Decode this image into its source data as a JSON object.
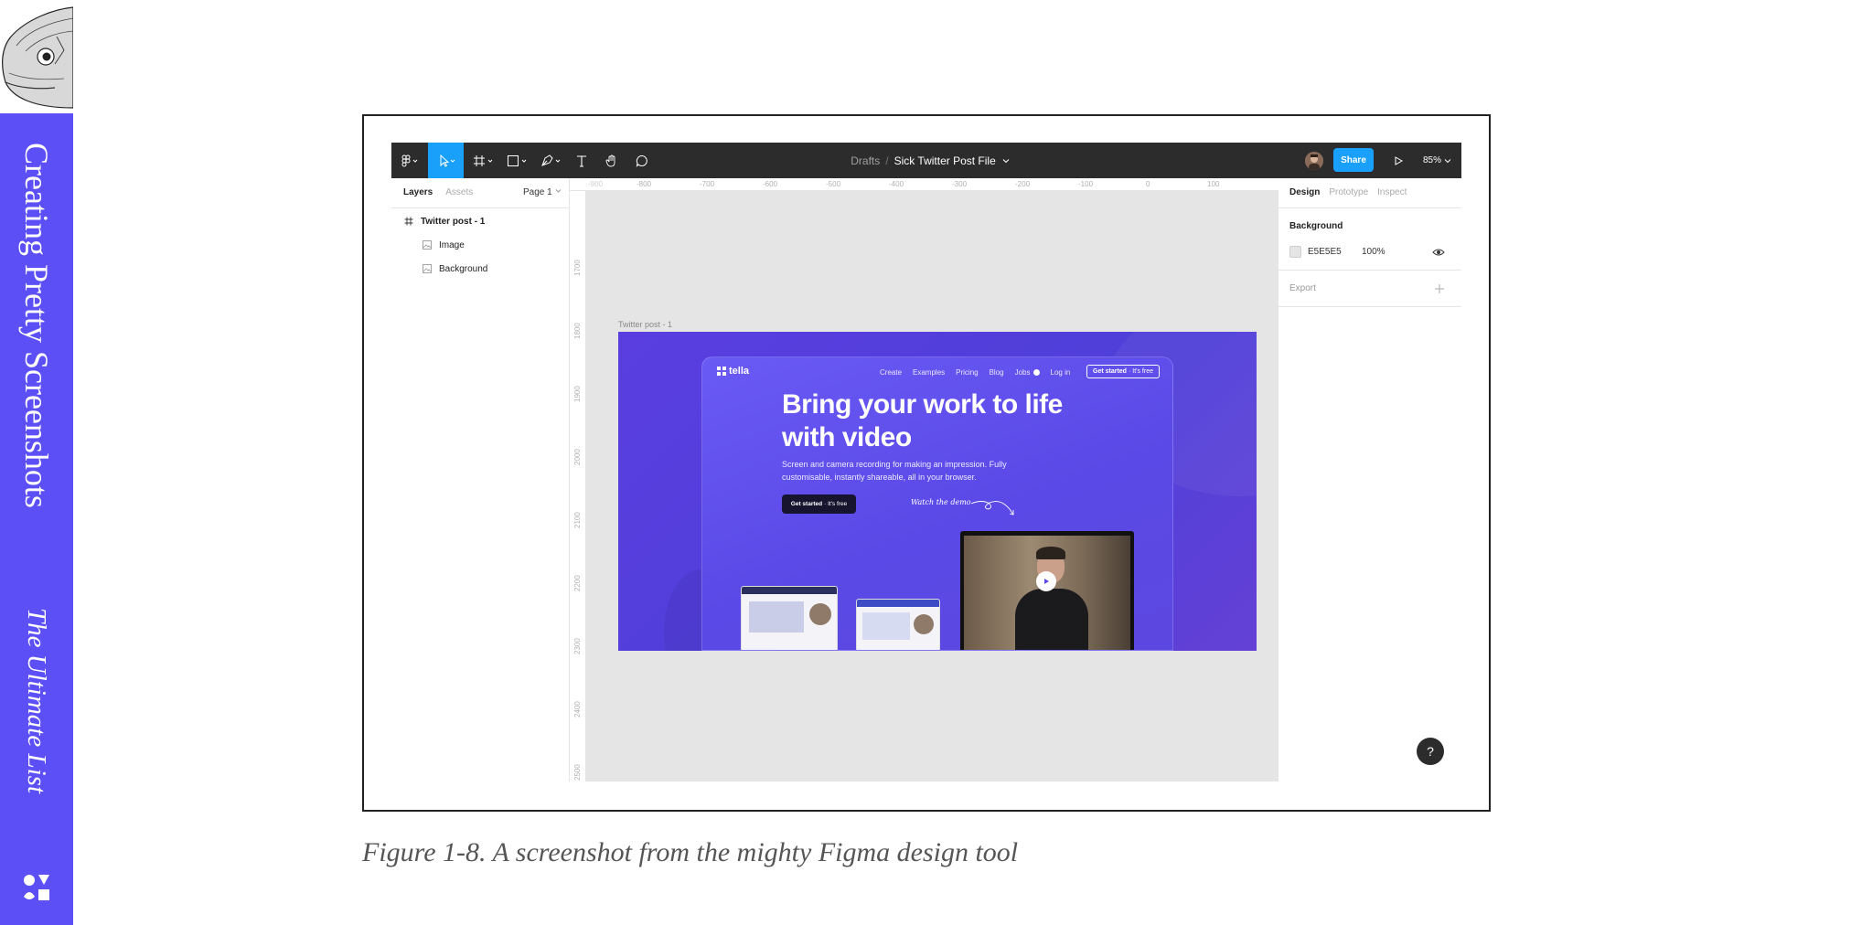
{
  "book": {
    "title": "Creating Pretty Screenshots",
    "subtitle": "The Ultimate List"
  },
  "caption": "Figure 1-8. A screenshot from the mighty Figma design tool",
  "figma": {
    "breadcrumb": {
      "drafts": "Drafts",
      "separator": "/",
      "file_name": "Sick Twitter Post File"
    },
    "share_label": "Share",
    "zoom_label": "85%",
    "left_panel": {
      "tabs": [
        "Layers",
        "Assets"
      ],
      "page_selector": "Page 1",
      "layers": [
        "Twitter post - 1",
        "Image",
        "Background"
      ]
    },
    "rulers": {
      "top": [
        "-900",
        "-800",
        "-700",
        "-600",
        "-500",
        "-400",
        "-300",
        "-200",
        "-100",
        "0",
        "100"
      ],
      "left": [
        "1700",
        "1800",
        "1900",
        "2000",
        "2100",
        "2200",
        "2300",
        "2400",
        "2500"
      ]
    },
    "canvas": {
      "frame_label": "Twitter post - 1"
    },
    "right_panel": {
      "tabs": [
        "Design",
        "Prototype",
        "Inspect"
      ],
      "background_label": "Background",
      "background_hex": "E5E5E5",
      "background_opacity": "100%",
      "export_label": "Export"
    },
    "help_label": "?"
  },
  "site": {
    "logo_text": "tella",
    "nav": [
      "Create",
      "Examples",
      "Pricing",
      "Blog",
      "Jobs",
      "Log in"
    ],
    "cta_strong": "Get started",
    "cta_light": "· It's free",
    "headline": "Bring your work to life with video",
    "subtext": "Screen and camera recording for making an impression. Fully customisable, instantly shareable, all in your browser.",
    "button_strong": "Get started",
    "button_light": "· It's free",
    "watch_demo": "Watch the demo"
  },
  "colors": {
    "sidebar": "#5b4ff5",
    "figma_accent": "#18a0fb",
    "toolbar": "#2c2c2c",
    "canvas": "#e5e5e5",
    "frame_bg": "#5a3ee0"
  }
}
